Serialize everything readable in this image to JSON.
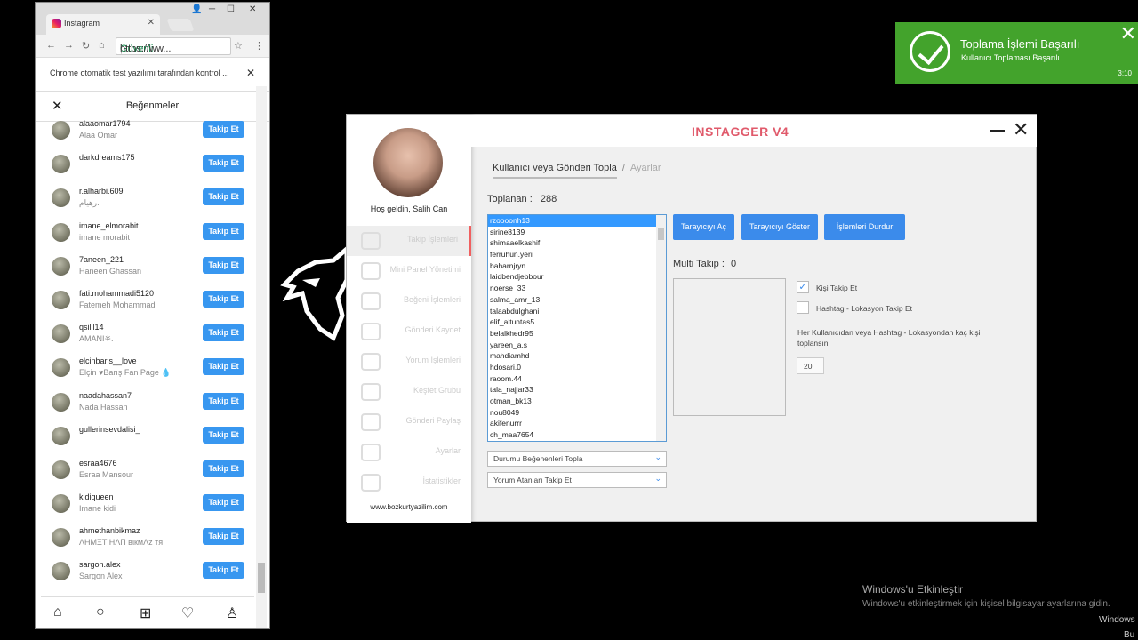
{
  "chrome": {
    "tab_title": "Instagram",
    "tab_close": "✕",
    "omnibox_secure": "Güvenli",
    "omnibox_url": "https://ww...",
    "infobar_text": "Chrome otomatik test yazılımı tarafından kontrol ...",
    "page_title": "Beğenmeler",
    "follow_label": "Takip Et"
  },
  "likes": [
    {
      "username": "alaaomar1794",
      "fullname": "Alaa Omar"
    },
    {
      "username": "darkdreams175",
      "fullname": ""
    },
    {
      "username": "r.alharbi.609",
      "fullname": "رهيام."
    },
    {
      "username": "imane_elmorabit",
      "fullname": "imane morabit"
    },
    {
      "username": "7aneen_221",
      "fullname": "Haneen Ghassan"
    },
    {
      "username": "fati.mohammadi5120",
      "fullname": "Fatemeh Mohammadi"
    },
    {
      "username": "qsilll14",
      "fullname": "AMANI※."
    },
    {
      "username": "elcinbaris__love",
      "fullname": "Elçin ♥Barış Fan Page 💧"
    },
    {
      "username": "naadahassan7",
      "fullname": "Nada Hassan"
    },
    {
      "username": "gullerinsevdalisi_",
      "fullname": ""
    },
    {
      "username": "esraa4676",
      "fullname": "Esraa Mansour"
    },
    {
      "username": "kidiqueen",
      "fullname": "Imane kidi"
    },
    {
      "username": "ahmethanbikmaz",
      "fullname": "ΛHMΞT HΛП вιкмΛz тя"
    },
    {
      "username": "sargon.alex",
      "fullname": "Sargon Alex"
    }
  ],
  "toast": {
    "title": "Toplama İşlemi Başarılı",
    "subtitle": "Kullanıcı Toplaması Başarılı",
    "time": "3:10"
  },
  "app": {
    "title": "INSTAGGER V4",
    "welcome": "Hoş geldin, Salih Can",
    "website": "www.bozkurtyazilim.com",
    "menu": [
      {
        "label": "Takip İşlemleri",
        "active": true
      },
      {
        "label": "Mini Panel Yönetimi",
        "active": false
      },
      {
        "label": "Beğeni İşlemleri",
        "active": false
      },
      {
        "label": "Gönderi Kaydet",
        "active": false
      },
      {
        "label": "Yorum İşlemleri",
        "active": false
      },
      {
        "label": "Keşfet Grubu",
        "active": false
      },
      {
        "label": "Gönderi Paylaş",
        "active": false
      },
      {
        "label": "Ayarlar",
        "active": false
      },
      {
        "label": "İstatistikler",
        "active": false
      }
    ],
    "tab_active": "Kullanıcı veya Gönderi Topla",
    "tab_sep": "/",
    "tab_inactive": "Ayarlar",
    "collected_label": "Toplanan :",
    "collected_value": "288",
    "users": [
      "rzoooonh13",
      "sirine8139",
      "shimaaelkashif",
      "ferruhun.yeri",
      "baharnjryn",
      "laidbendjebbour",
      "noerse_33",
      "salma_amr_13",
      "talaabdulghani",
      "elif_altuntas5",
      "belalkhedr95",
      "yareen_a.s",
      "mahdiamhd",
      "hdosari.0",
      "raoom.44",
      "tala_najjar33",
      "otman_bk13",
      "nou8049",
      "akifenurrr",
      "ch_maa7654"
    ],
    "btn_open": "Tarayıcıyı Aç",
    "btn_show": "Tarayıcıyı Göster",
    "btn_stop": "İşlemleri Durdur",
    "multi_label": "Multi Takip :",
    "multi_value": "0",
    "chk1_label": "Kişi Takip Et",
    "chk1_checked": true,
    "chk2_label": "Hashtag - Lokasyon Takip Et",
    "chk2_checked": false,
    "desc": "Her Kullanıcıdan veya Hashtag - Lokasyondan kaç kişi toplansın",
    "count_value": "20",
    "dropdown1": "Durumu Beğenenleri Topla",
    "dropdown2": "Yorum Atanları Takip Et"
  },
  "watermark": {
    "line1": "Windows'u Etkinleştir",
    "line2": "Windows'u etkinleştirmek için kişisel bilgisayar ayarlarına gidin.",
    "line3": "Windows",
    "line4": "Bu"
  }
}
